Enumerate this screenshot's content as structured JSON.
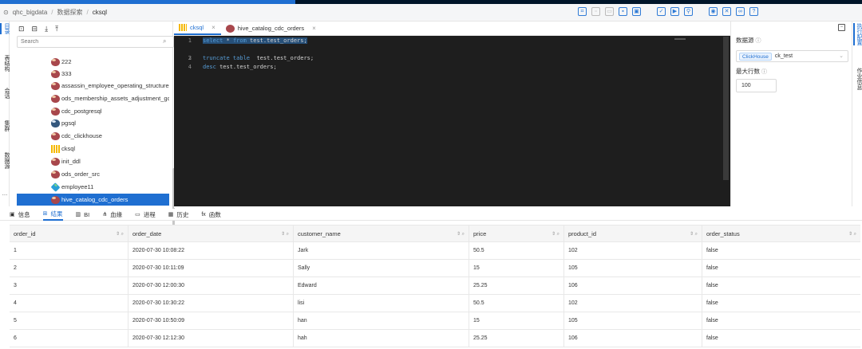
{
  "breadcrumb": {
    "project": "qhc_bigdata",
    "section": "数据探索",
    "current": "cksql"
  },
  "left_rail": [
    "目录",
    "表结构",
    "会话",
    "集群",
    "数据源"
  ],
  "left_rail_more": "…",
  "tree": {
    "search_placeholder": "Search",
    "items": [
      {
        "label": "222",
        "icon": "hive-icon"
      },
      {
        "label": "333",
        "icon": "hive-icon"
      },
      {
        "label": "assassin_employee_operating_structure",
        "icon": "hive-icon"
      },
      {
        "label": "ods_membership_assets_adjustment_gc",
        "icon": "hive-icon"
      },
      {
        "label": "cdc_postgresql",
        "icon": "hive-icon"
      },
      {
        "label": "pgsql",
        "icon": "postgresql-icon"
      },
      {
        "label": "cdc_clickhouse",
        "icon": "hive-icon"
      },
      {
        "label": "cksql",
        "icon": "clickhouse-icon"
      },
      {
        "label": "init_ddl",
        "icon": "hive-icon"
      },
      {
        "label": "ods_order_src",
        "icon": "hive-icon"
      },
      {
        "label": "employee11",
        "icon": "kafka-icon"
      },
      {
        "label": "hive_catalog_cdc_orders",
        "icon": "hive-icon",
        "selected": true
      }
    ]
  },
  "tabs": [
    {
      "label": "cksql",
      "active": true
    },
    {
      "label": "hive_catalog_cdc_orders",
      "active": false
    }
  ],
  "editor": {
    "lines": [
      "1",
      "2",
      "3",
      "4"
    ],
    "line1_kw1": "select",
    "line1_star": " * ",
    "line1_kw2": "from",
    "line1_rest": " test.test_orders;",
    "line3_kw": "truncate table",
    "line3_rest": "  test.test_orders;",
    "line4_kw": "desc",
    "line4_rest": " test.test_orders;"
  },
  "right_panel": {
    "datasource_label": "数据源",
    "datasource_type": "ClickHouse",
    "datasource_value": "ck_test",
    "max_rows_label": "最大行数",
    "max_rows_value": "100"
  },
  "right_rail": [
    "执行配置",
    "作业信息"
  ],
  "bottom_tabs": [
    {
      "label": "信息",
      "icon": "info-icon",
      "active": false
    },
    {
      "label": "结果",
      "icon": "table-icon",
      "active": true
    },
    {
      "label": "BI",
      "icon": "bar-chart-icon",
      "active": false
    },
    {
      "label": "血缘",
      "icon": "lineage-icon",
      "active": false
    },
    {
      "label": "进程",
      "icon": "monitor-icon",
      "active": false
    },
    {
      "label": "历史",
      "icon": "calendar-icon",
      "active": false
    },
    {
      "label": "函数",
      "icon": "function-icon",
      "active": false
    }
  ],
  "results": {
    "columns": [
      "order_id",
      "order_date",
      "customer_name",
      "price",
      "product_id",
      "order_status"
    ],
    "rows": [
      [
        "1",
        "2020-07-30 10:08:22",
        "Jark",
        "50.5",
        "102",
        "false"
      ],
      [
        "2",
        "2020-07-30 10:11:09",
        "Sally",
        "15",
        "105",
        "false"
      ],
      [
        "3",
        "2020-07-30 12:00:30",
        "Edward",
        "25.25",
        "106",
        "false"
      ],
      [
        "4",
        "2020-07-30 10:30:22",
        "lisi",
        "50.5",
        "102",
        "false"
      ],
      [
        "5",
        "2020-07-30 10:50:09",
        "han",
        "15",
        "105",
        "false"
      ],
      [
        "6",
        "2020-07-30 12:12:30",
        "hah",
        "25.25",
        "106",
        "false"
      ]
    ]
  },
  "colors": {
    "accent": "#1f6fd1",
    "editor_bg": "#1e1e1e",
    "keyword": "#569cd6"
  }
}
